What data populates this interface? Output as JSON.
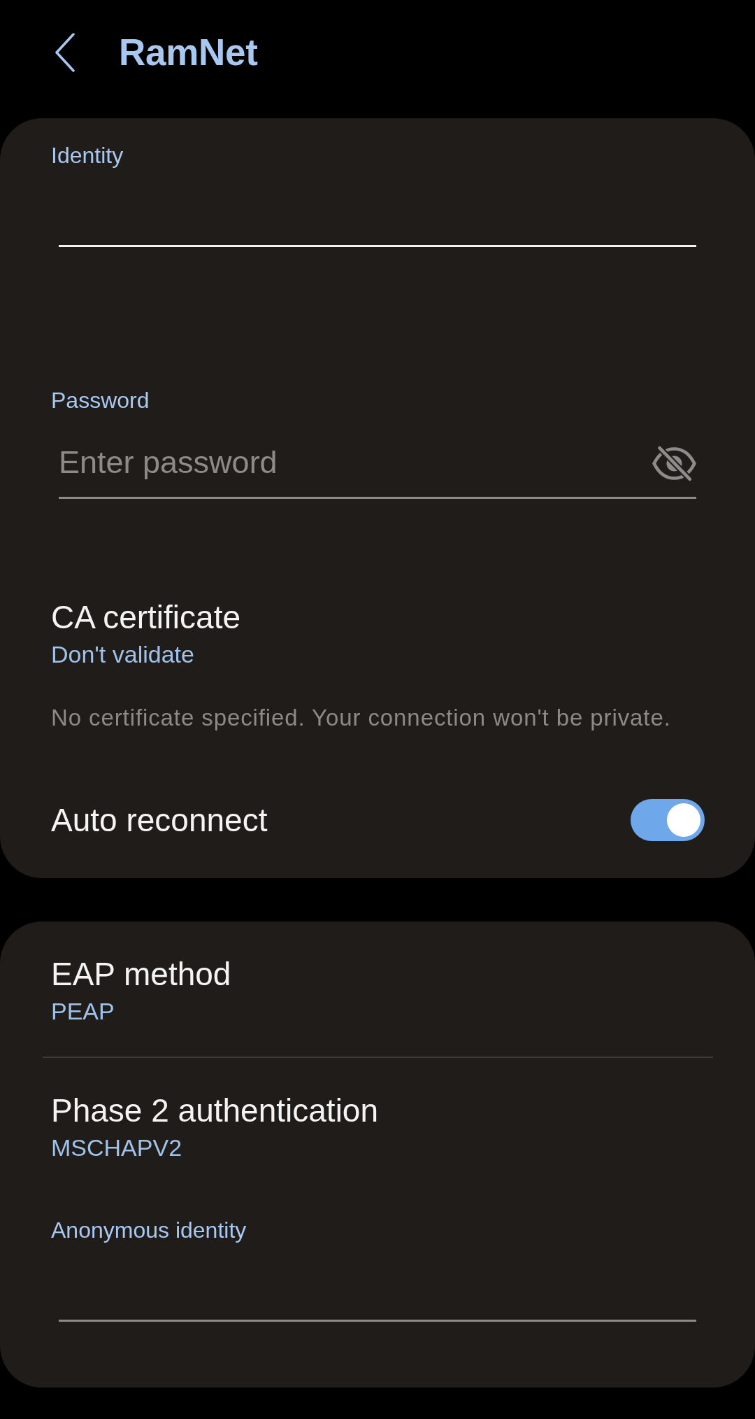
{
  "header": {
    "title": "RamNet"
  },
  "cards": [
    {
      "items": [
        {
          "kind": "field",
          "label": "Identity",
          "focused": true
        },
        {
          "kind": "field",
          "label": "Password",
          "placeholder": "Enter password",
          "focused": false,
          "visibility_toggle": true
        },
        {
          "kind": "setting",
          "title": "CA certificate",
          "value": "Don't validate",
          "note": "No certificate specified. Your connection won't be private."
        },
        {
          "kind": "switch",
          "title": "Auto reconnect",
          "on": true
        }
      ]
    },
    {
      "items": [
        {
          "kind": "setting",
          "title": "EAP method",
          "value": "PEAP"
        },
        {
          "kind": "setting",
          "title": "Phase 2 authentication",
          "value": "MSCHAPV2"
        },
        {
          "kind": "field",
          "label": "Anonymous identity",
          "focused": false
        }
      ]
    }
  ]
}
